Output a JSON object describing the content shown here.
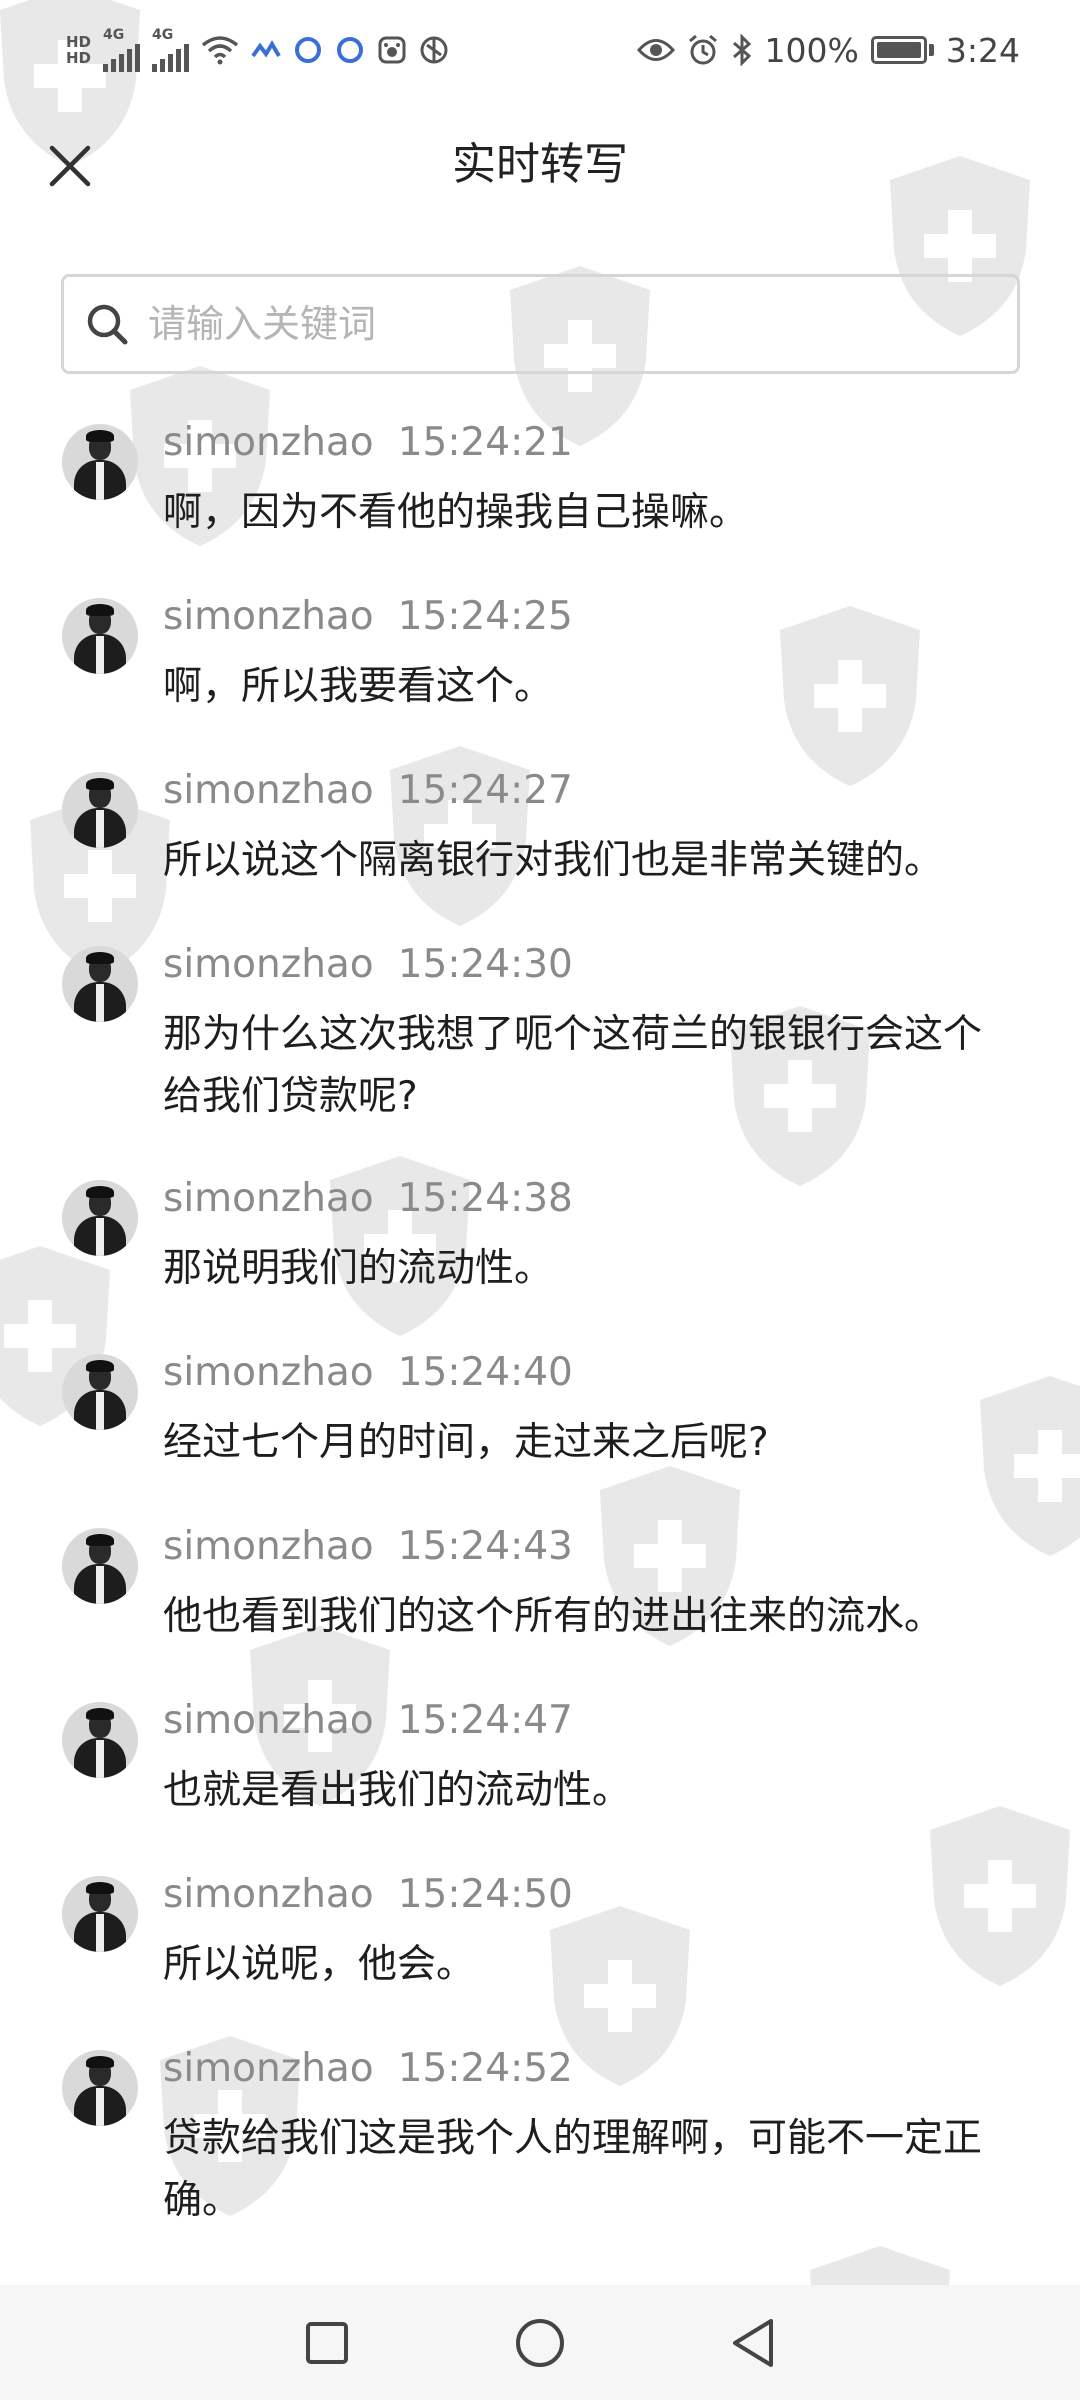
{
  "status_bar": {
    "left_labels": [
      "HD",
      "HD",
      "4G",
      "4G"
    ],
    "battery_percent": "100%",
    "time": "3:24",
    "icons": [
      "signal-icon",
      "wifi-icon",
      "app-notification-icon",
      "eye-icon",
      "alarm-icon",
      "bluetooth-icon",
      "battery-icon"
    ]
  },
  "header": {
    "title": "实时转写",
    "close_icon": "close-icon"
  },
  "search": {
    "placeholder": "请输入关键词",
    "value": "",
    "icon": "search-icon"
  },
  "messages": [
    {
      "speaker": "simonzhao",
      "time": "15:24:21",
      "text": "啊，因为不看他的操我自己操嘛。"
    },
    {
      "speaker": "simonzhao",
      "time": "15:24:25",
      "text": "啊，所以我要看这个。"
    },
    {
      "speaker": "simonzhao",
      "time": "15:24:27",
      "text": "所以说这个隔离银行对我们也是非常关键的。"
    },
    {
      "speaker": "simonzhao",
      "time": "15:24:30",
      "text": "那为什么这次我想了呃个这荷兰的银银行会这个给我们贷款呢?"
    },
    {
      "speaker": "simonzhao",
      "time": "15:24:38",
      "text": "那说明我们的流动性。"
    },
    {
      "speaker": "simonzhao",
      "time": "15:24:40",
      "text": "经过七个月的时间，走过来之后呢?"
    },
    {
      "speaker": "simonzhao",
      "time": "15:24:43",
      "text": "他也看到我们的这个所有的进出往来的流水。"
    },
    {
      "speaker": "simonzhao",
      "time": "15:24:47",
      "text": "也就是看出我们的流动性。"
    },
    {
      "speaker": "simonzhao",
      "time": "15:24:50",
      "text": "所以说呢，他会。"
    },
    {
      "speaker": "simonzhao",
      "time": "15:24:52",
      "text": "贷款给我们这是我个人的理解啊，可能不一定正确。"
    }
  ],
  "navbar": {
    "icons": [
      "recent-apps-icon",
      "home-icon",
      "back-icon"
    ]
  },
  "colors": {
    "text": "#1e1e1e",
    "meta": "#8a8a8a",
    "border": "#d6d6d6",
    "placeholder": "#b5b5b5",
    "watermark": "#9a9a9a"
  }
}
